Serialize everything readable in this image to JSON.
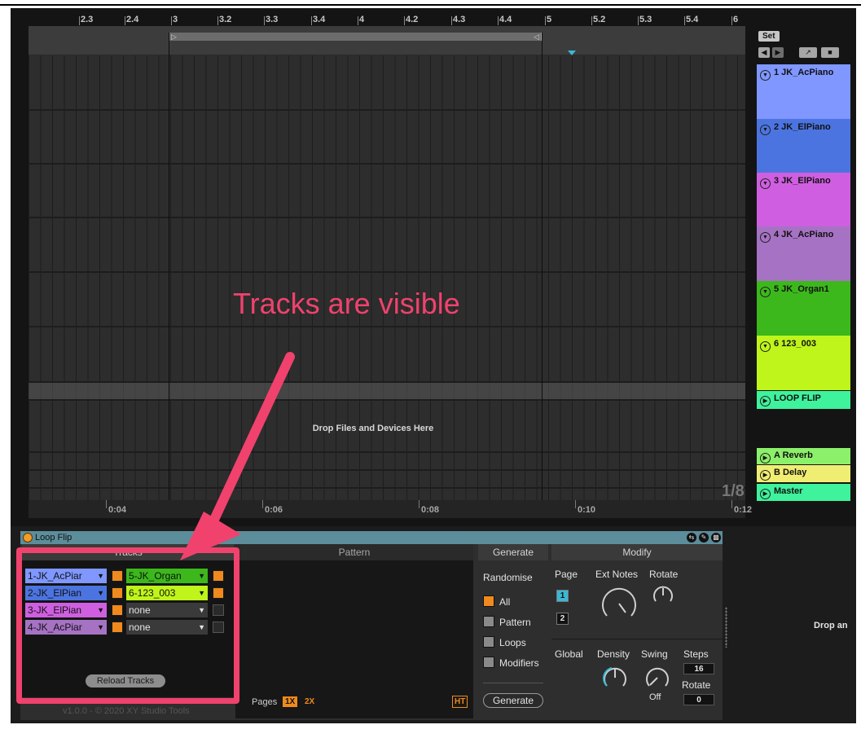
{
  "arrangement": {
    "bar_labels": [
      "2.3",
      "2.4",
      "3",
      "3.2",
      "3.3",
      "3.4",
      "4",
      "4.2",
      "4.3",
      "4.4",
      "5",
      "5.2",
      "5.3",
      "5.4",
      "6"
    ],
    "time_labels": [
      "0:04",
      "0:06",
      "0:08",
      "0:10",
      "0:12"
    ],
    "drop_text": "Drop Files and Devices Here",
    "zoom_ratio": "1/8",
    "set_button": "Set"
  },
  "tracks": [
    {
      "name": "1 JK_AcPiano",
      "color": "#7f97ff"
    },
    {
      "name": "2 JK_ElPiano",
      "color": "#4c74e0"
    },
    {
      "name": "3 JK_ElPiano",
      "color": "#cf5fe0"
    },
    {
      "name": "4 JK_AcPiano",
      "color": "#a672c4"
    },
    {
      "name": "5 JK_Organ1",
      "color": "#3cb81c"
    },
    {
      "name": "6 123_003",
      "color": "#bff51a"
    },
    {
      "name": "LOOP FLIP",
      "color": "#3ff29c"
    },
    {
      "name": "A Reverb",
      "color": "#8cf06a"
    },
    {
      "name": "B Delay",
      "color": "#f0ee72"
    },
    {
      "name": "Master",
      "color": "#3ff29c"
    }
  ],
  "device": {
    "title": "Loop Flip",
    "tracks_section": {
      "heading": "Tracks",
      "left_column": [
        {
          "label": "1-JK_AcPiar",
          "color": "#7f97ff",
          "checked": true
        },
        {
          "label": "2-JK_ElPian",
          "color": "#4c74e0",
          "checked": true
        },
        {
          "label": "3-JK_ElPian",
          "color": "#cf5fe0",
          "checked": true
        },
        {
          "label": "4-JK_AcPiar",
          "color": "#a672c4",
          "checked": true
        }
      ],
      "right_column": [
        {
          "label": "5-JK_Organ",
          "color": "#3cb81c",
          "checked": true
        },
        {
          "label": "6-123_003",
          "color": "#bff51a",
          "checked": true
        },
        {
          "label": "none",
          "color": "#3a3a3a",
          "checked": false
        },
        {
          "label": "none",
          "color": "#3a3a3a",
          "checked": false
        }
      ],
      "reload_button": "Reload Tracks"
    },
    "pattern_section": {
      "heading": "Pattern",
      "pages_label": "Pages",
      "page_1x": "1X",
      "page_2x": "2X",
      "ht_label": "HT"
    },
    "generate_section": {
      "heading": "Generate",
      "randomise_label": "Randomise",
      "options": [
        {
          "label": "All",
          "checked": true
        },
        {
          "label": "Pattern",
          "checked": false
        },
        {
          "label": "Loops",
          "checked": false
        },
        {
          "label": "Modifiers",
          "checked": false
        }
      ],
      "generate_button": "Generate"
    },
    "modify_section": {
      "heading": "Modify",
      "page_label": "Page",
      "page_1": "1",
      "page_2": "2",
      "ext_notes_label": "Ext Notes",
      "rotate_label": "Rotate",
      "global_label": "Global",
      "density_label": "Density",
      "swing_label": "Swing",
      "swing_value": "Off",
      "steps_label": "Steps",
      "steps_value": "16",
      "rotate2_label": "Rotate",
      "rotate2_value": "0"
    },
    "footer_text": "v1.0.0 - © 2020 XY Studio Tools",
    "side_drop_text": "Drop an"
  },
  "annotation": {
    "text": "Tracks are visible",
    "color": "#f0426d"
  }
}
